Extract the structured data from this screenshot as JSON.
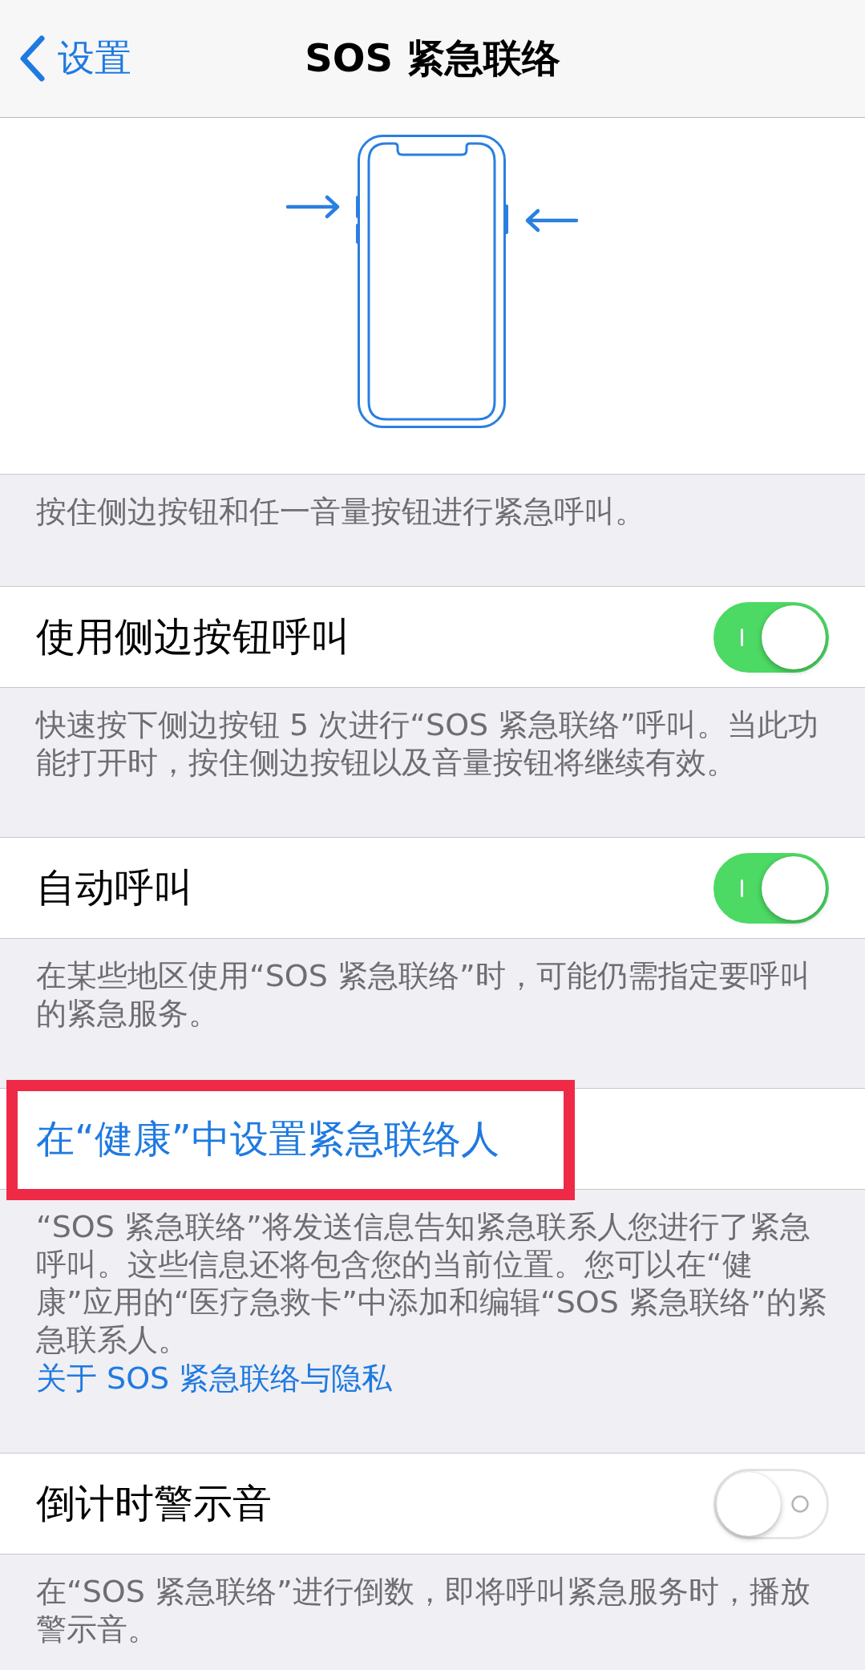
{
  "nav_bar": {
    "back_label": "设置",
    "title": "SOS 紧急联络"
  },
  "sections": [
    {
      "kind": "illustration",
      "footer": "按住侧边按钮和任一音量按钮进行紧急呼叫。"
    },
    {
      "kind": "toggle",
      "label": "使用侧边按钮呼叫",
      "on": true,
      "footer": "快速按下侧边按钮 5 次进行“SOS 紧急联络”呼叫。当此功能打开时，按住侧边按钮以及音量按钮将继续有效。"
    },
    {
      "kind": "toggle",
      "label": "自动呼叫",
      "on": true,
      "footer": "在某些地区使用“SOS 紧急联络”时，可能仍需指定要呼叫的紧急服务。"
    },
    {
      "kind": "link",
      "label": "在“健康”中设置紧急联络人",
      "highlighted": true,
      "footer": "“SOS 紧急联络”将发送信息告知紧急联系人您进行了紧急呼叫。这些信息还将包含您的当前位置。您可以在“健康”应用的“医疗急救卡”中添加和编辑“SOS 紧急联络”的紧急联系人。",
      "footer_link": "关于 SOS 紧急联络与隐私"
    },
    {
      "kind": "toggle",
      "label": "倒计时警示音",
      "on": false,
      "footer": "在“SOS 紧急联络”进行倒数，即将呼叫紧急服务时，播放警示音。"
    }
  ]
}
